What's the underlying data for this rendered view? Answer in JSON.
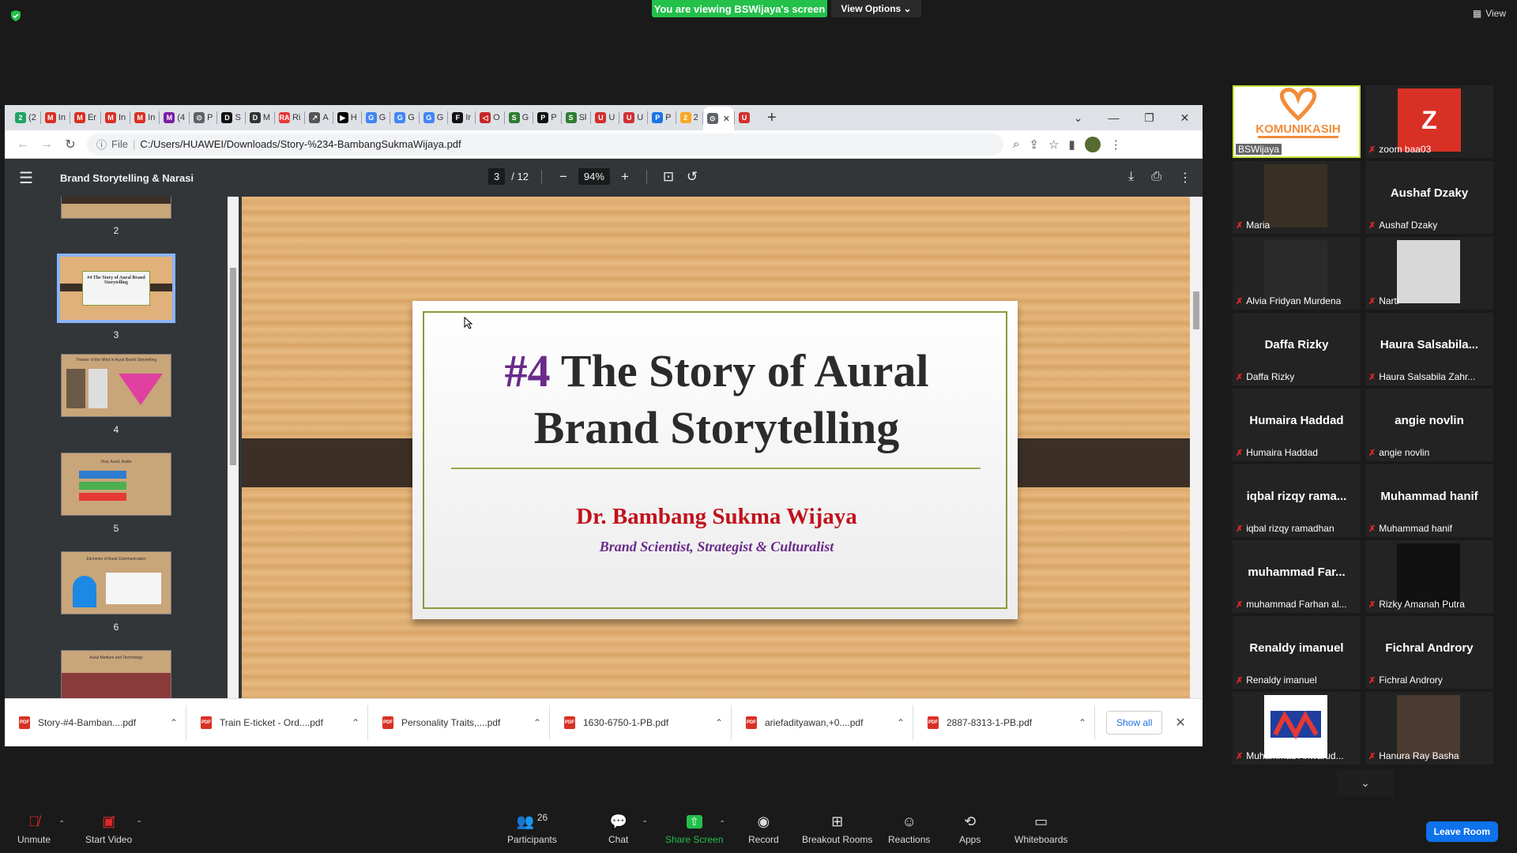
{
  "zoom": {
    "viewing_banner": "You are viewing BSWijaya's screen",
    "view_options": "View Options",
    "view_label": "View",
    "participants_count": "26",
    "toolbar": {
      "unmute": "Unmute",
      "start_video": "Start Video",
      "participants": "Participants",
      "chat": "Chat",
      "share_screen": "Share Screen",
      "record": "Record",
      "breakout_rooms": "Breakout Rooms",
      "reactions": "Reactions",
      "apps": "Apps",
      "whiteboards": "Whiteboards",
      "leave_room": "Leave Room"
    }
  },
  "browser": {
    "tab_fav_letters": [
      "2",
      "M",
      "M",
      "M",
      "M",
      "M",
      "⊙",
      "D",
      "D",
      "RA",
      "↗",
      "▶",
      "G",
      "G",
      "G",
      "F",
      "◁",
      "S",
      "P",
      "S",
      "U",
      "U",
      "P",
      "2",
      "⊙",
      "U"
    ],
    "tab_fav_colors": [
      "#1fa463",
      "#d93025",
      "#d93025",
      "#d93025",
      "#d93025",
      "#7b1fa2",
      "#5f6368",
      "#111111",
      "#333333",
      "#e53935",
      "#555555",
      "#000000",
      "#4285f4",
      "#4285f4",
      "#4285f4",
      "#111111",
      "#c62828",
      "#2e7d32",
      "#111111",
      "#2e7d32",
      "#d32f2f",
      "#d32f2f",
      "#1a73e8",
      "#f9a825",
      "#5f6368",
      "#d32f2f"
    ],
    "tab_labels": [
      "(2",
      "In",
      "Er",
      "In",
      "In",
      "(4",
      "P",
      "S",
      "M",
      "Ri",
      "A",
      "H",
      "G",
      "G",
      "G",
      "Ir",
      "O",
      "G",
      "P",
      "Sl",
      "U",
      "U",
      "P",
      "2",
      "",
      ""
    ],
    "url_label": "File",
    "url": "C:/Users/HUAWEI/Downloads/Story-%234-BambangSukmaWijaya.pdf"
  },
  "pdf": {
    "title": "Brand Storytelling & Narasi",
    "current_page": "3",
    "total_pages": "/ 12",
    "zoom": "94%",
    "thumbnails": [
      {
        "num": "2"
      },
      {
        "num": "3",
        "caption": "#4 The Story of Aural Brand Storytelling"
      },
      {
        "num": "4",
        "caption": "Theater of the Mind in Aural Brand Storytelling"
      },
      {
        "num": "5",
        "caption": "Oral, Aural, Audio"
      },
      {
        "num": "6",
        "caption": "Elements of Aural Communication"
      },
      {
        "num": "",
        "caption": "Aural Medium and Technology"
      }
    ],
    "slide": {
      "title_num": "#4",
      "title_rest_line1": " The Story of  Aural",
      "title_line2": "Brand Storytelling",
      "author": "Dr. Bambang Sukma Wijaya",
      "role": "Brand Scientist, Strategist & Culturalist"
    }
  },
  "downloads": {
    "items": [
      "Story-#4-Bamban....pdf",
      "Train E-ticket - Ord....pdf",
      "Personality Traits,....pdf",
      "1630-6750-1-PB.pdf",
      "ariefadityawan,+0....pdf",
      "2887-8313-1-PB.pdf"
    ],
    "show_all": "Show all"
  },
  "participants": [
    {
      "big": "",
      "label": "BSWijaya",
      "muted": false
    },
    {
      "big": "Z",
      "label": "zoom baa03",
      "muted": true
    },
    {
      "big": "",
      "label": "Maria",
      "muted": true
    },
    {
      "big": "Aushaf Dzaky",
      "label": "Aushaf Dzaky",
      "muted": true
    },
    {
      "big": "",
      "label": "Alvia Fridyan Murdena",
      "muted": true
    },
    {
      "big": "",
      "label": "Narti",
      "muted": true
    },
    {
      "big": "Daffa Rizky",
      "label": "Daffa Rizky",
      "muted": true
    },
    {
      "big": "Haura  Salsabila...",
      "label": "Haura Salsabila Zahr...",
      "muted": true
    },
    {
      "big": "Humaira Haddad",
      "label": "Humaira Haddad",
      "muted": true
    },
    {
      "big": "angie novlin",
      "label": "angie novlin",
      "muted": true
    },
    {
      "big": "iqbal  rizqy  rama...",
      "label": "iqbal rizqy ramadhan",
      "muted": true
    },
    {
      "big": "Muhammad hanif",
      "label": "Muhammad hanif",
      "muted": true
    },
    {
      "big": "muhammad  Far...",
      "label": "muhammad Farhan al...",
      "muted": true
    },
    {
      "big": "",
      "label": "Rizky Amanah Putra",
      "muted": true
    },
    {
      "big": "Renaldy imanuel",
      "label": "Renaldy imanuel",
      "muted": true
    },
    {
      "big": "Fichral Androry",
      "label": "Fichral Androry",
      "muted": true
    },
    {
      "big": "",
      "label": "Muhammad Anwarud...",
      "muted": true
    },
    {
      "big": "",
      "label": "Hanura Ray Basha",
      "muted": true
    }
  ],
  "logo_text": "KOMUNIKASIH",
  "colors": {
    "zoom_green": "#23c04a",
    "zoom_blue": "#0e72ed",
    "mute_red": "#e02828",
    "slide_purple": "#6a2a8a",
    "slide_red": "#c0121b"
  }
}
